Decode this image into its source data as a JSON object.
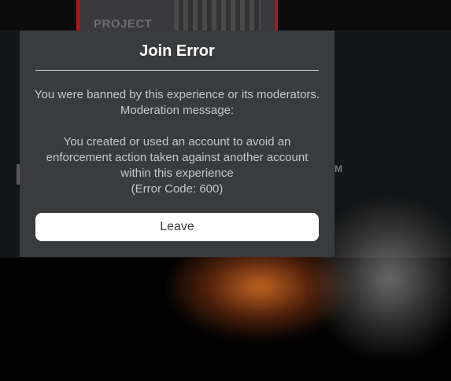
{
  "background": {
    "thumbnail_label": "PROJECT",
    "right_fragment": "M"
  },
  "dialog": {
    "title": "Join Error",
    "intro": "You were banned by this experience or its moderators. Moderation message:",
    "reason": "You created or used an account to avoid an enforcement action taken against another account within this experience",
    "error_code": "(Error Code: 600)",
    "leave_label": "Leave"
  },
  "colors": {
    "dialog_bg": "#393b3d",
    "button_bg": "#ffffff",
    "title": "#ffffff",
    "body_text": "#c5c6c7",
    "thumbnail_border": "#b3151b"
  }
}
